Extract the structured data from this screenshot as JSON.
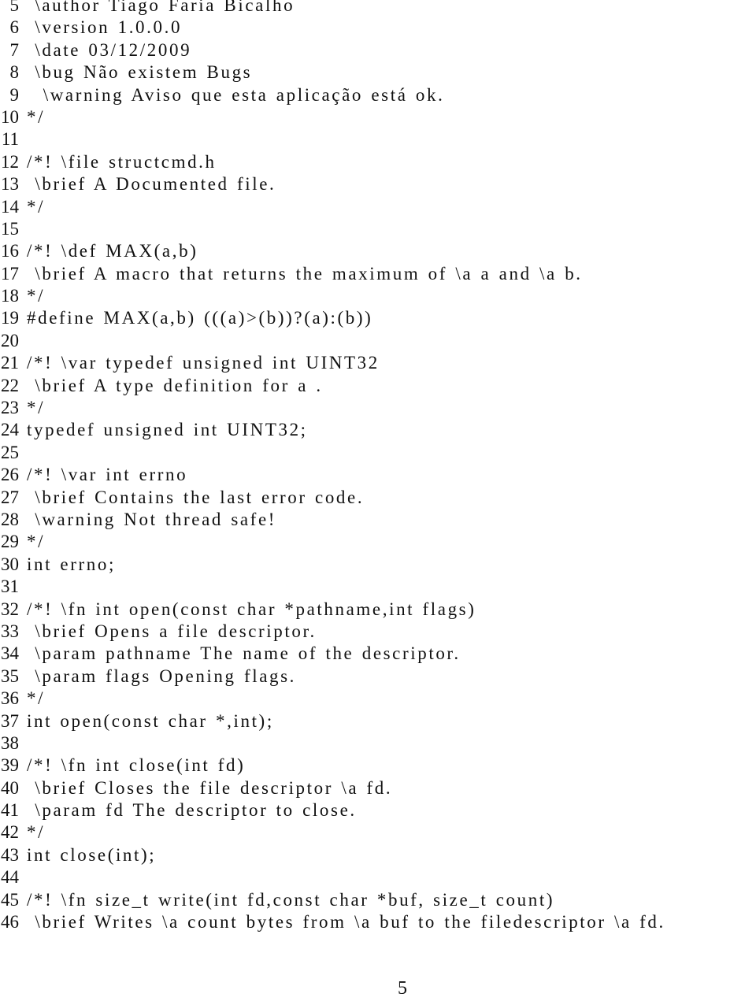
{
  "listing": {
    "lines": [
      {
        "number": "5",
        "text": " \\author Tiago Faria Bicalho"
      },
      {
        "number": "6",
        "text": " \\version 1.0.0.0"
      },
      {
        "number": "7",
        "text": " \\date 03/12/2009"
      },
      {
        "number": "8",
        "text": " \\bug Não existem Bugs"
      },
      {
        "number": "9",
        "text": "  \\warning Aviso que esta aplicação está ok."
      },
      {
        "number": "10",
        "text": "*/"
      },
      {
        "number": "11",
        "text": ""
      },
      {
        "number": "12",
        "text": "/*! \\file structcmd.h"
      },
      {
        "number": "13",
        "text": " \\brief A Documented file."
      },
      {
        "number": "14",
        "text": "*/"
      },
      {
        "number": "15",
        "text": ""
      },
      {
        "number": "16",
        "text": "/*! \\def MAX(a,b)"
      },
      {
        "number": "17",
        "text": " \\brief A macro that returns the maximum of \\a a and \\a b."
      },
      {
        "number": "18",
        "text": "*/"
      },
      {
        "number": "19",
        "text": "#define MAX(a,b) (((a)>(b))?(a):(b))"
      },
      {
        "number": "20",
        "text": ""
      },
      {
        "number": "21",
        "text": "/*! \\var typedef unsigned int UINT32"
      },
      {
        "number": "22",
        "text": " \\brief A type definition for a ."
      },
      {
        "number": "23",
        "text": "*/"
      },
      {
        "number": "24",
        "text": "typedef unsigned int UINT32;"
      },
      {
        "number": "25",
        "text": ""
      },
      {
        "number": "26",
        "text": "/*! \\var int errno"
      },
      {
        "number": "27",
        "text": " \\brief Contains the last error code."
      },
      {
        "number": "28",
        "text": " \\warning Not thread safe!"
      },
      {
        "number": "29",
        "text": "*/"
      },
      {
        "number": "30",
        "text": "int errno;"
      },
      {
        "number": "31",
        "text": ""
      },
      {
        "number": "32",
        "text": "/*! \\fn int open(const char *pathname,int flags)"
      },
      {
        "number": "33",
        "text": " \\brief Opens a file descriptor."
      },
      {
        "number": "34",
        "text": " \\param pathname The name of the descriptor."
      },
      {
        "number": "35",
        "text": " \\param flags Opening flags."
      },
      {
        "number": "36",
        "text": "*/"
      },
      {
        "number": "37",
        "text": "int open(const char *,int);"
      },
      {
        "number": "38",
        "text": ""
      },
      {
        "number": "39",
        "text": "/*! \\fn int close(int fd)"
      },
      {
        "number": "40",
        "text": " \\brief Closes the file descriptor \\a fd."
      },
      {
        "number": "41",
        "text": " \\param fd The descriptor to close."
      },
      {
        "number": "42",
        "text": "*/"
      },
      {
        "number": "43",
        "text": "int close(int);"
      },
      {
        "number": "44",
        "text": ""
      },
      {
        "number": "45",
        "text": "/*! \\fn size_t write(int fd,const char *buf, size_t count)"
      },
      {
        "number": "46",
        "text": " \\brief Writes \\a count bytes from \\a buf to the filedescriptor \\a fd."
      }
    ]
  },
  "footer": {
    "page_number": "5"
  }
}
